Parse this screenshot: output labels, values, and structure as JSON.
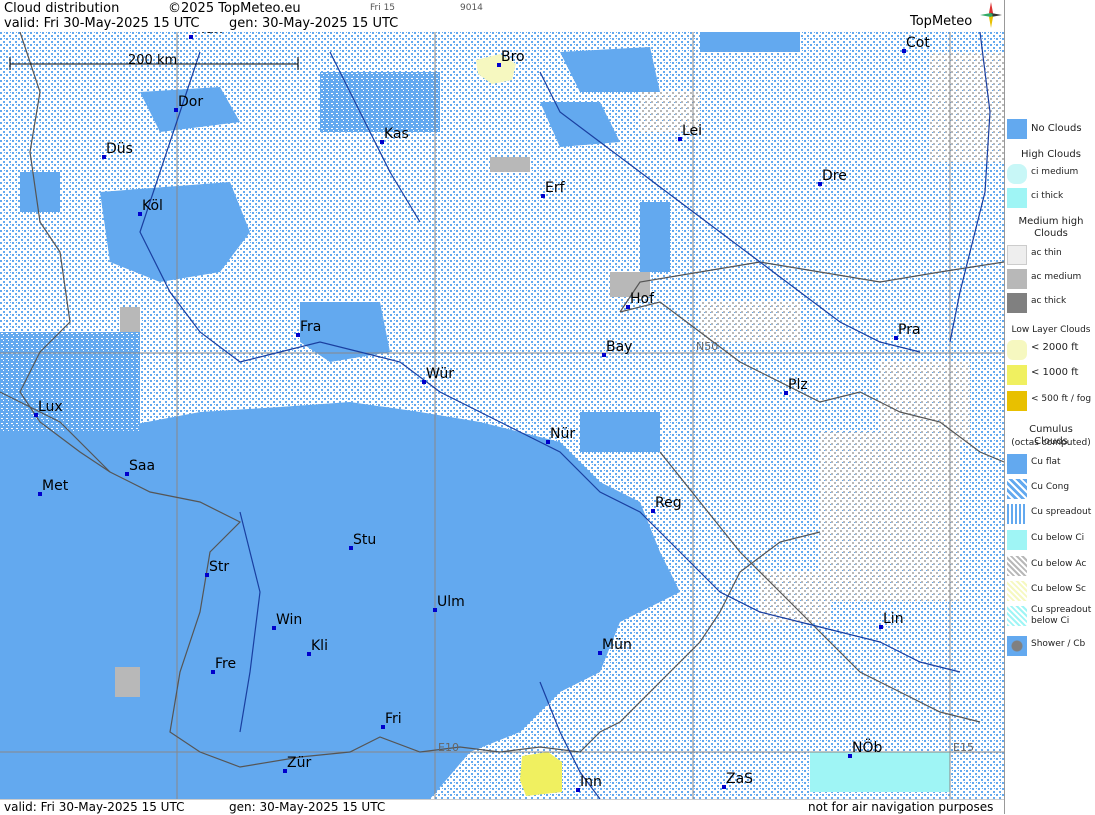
{
  "header": {
    "title": "Cloud distribution",
    "copyright": "©2025 TopMeteo.eu",
    "valid_label": "valid:  Fri  30-May-2025  15 UTC",
    "gen_label": "gen: 30-May-2025 15 UTC",
    "small_tag_1": "Fri 15",
    "small_tag_2": "9014",
    "brand": "TopMeteo"
  },
  "footer": {
    "valid_label": "valid:  Fri  30-May-2025  15 UTC",
    "gen_label": "gen: 30-May-2025 15 UTC",
    "disclaimer": "not for air navigation purposes"
  },
  "map": {
    "scale_label": "200 km",
    "grid_labels": {
      "n50": "N50",
      "e10": "E10",
      "e15": "E15"
    },
    "cities": [
      {
        "name": "Mün"
      },
      {
        "name": "Bro"
      },
      {
        "name": "Cot"
      },
      {
        "name": "Dor"
      },
      {
        "name": "Lei"
      },
      {
        "name": "Kas"
      },
      {
        "name": "Düs"
      },
      {
        "name": "Dre"
      },
      {
        "name": "Erf"
      },
      {
        "name": "Köl"
      },
      {
        "name": "Hof"
      },
      {
        "name": "Fra"
      },
      {
        "name": "Pra"
      },
      {
        "name": "Bay"
      },
      {
        "name": "Wür"
      },
      {
        "name": "Plz"
      },
      {
        "name": "Lux"
      },
      {
        "name": "Nür"
      },
      {
        "name": "Saa"
      },
      {
        "name": "Met"
      },
      {
        "name": "Reg"
      },
      {
        "name": "Stu"
      },
      {
        "name": "Str"
      },
      {
        "name": "Ulm"
      },
      {
        "name": "Win"
      },
      {
        "name": "Lin"
      },
      {
        "name": "Kli"
      },
      {
        "name": "Mün"
      },
      {
        "name": "Fre"
      },
      {
        "name": "Fri"
      },
      {
        "name": "NÖb"
      },
      {
        "name": "Zür"
      },
      {
        "name": "ZaS"
      },
      {
        "name": "Inn"
      }
    ]
  },
  "legend": {
    "no_clouds": "No Clouds",
    "high_head": "High Clouds",
    "ci_medium": "ci medium",
    "ci_thick": "ci thick",
    "medium_head": "Medium high Clouds",
    "ac_thin": "ac thin",
    "ac_medium": "ac medium",
    "ac_thick": "ac thick",
    "low_head": "Low Layer Clouds",
    "low_2000": "< 2000 ft",
    "low_1000": "< 1000 ft",
    "low_500": "< 500 ft / fog",
    "cu_head": "Cumulus Clouds",
    "cu_sub": "(octas computed)",
    "cu_flat": "Cu flat",
    "cu_cong": "Cu Cong",
    "cu_spreadout": "Cu spreadout",
    "cu_below_ci": "Cu below Ci",
    "cu_below_ac": "Cu below Ac",
    "cu_below_sc": "Cu below Sc",
    "cu_spreadout_ci_1": "Cu spreadout",
    "cu_spreadout_ci_2": "below Ci",
    "shower": "Shower / Cb"
  },
  "colors": {
    "no_clouds": "#63a9ef",
    "ci": "#9ff5f5",
    "ac": "#b8b8b8",
    "ac_thick": "#808080",
    "low_2000": "#f6f8c0",
    "low_1000": "#f0f060",
    "fog": "#e8c000",
    "border": "#555555",
    "river": "#1a3fa0",
    "city_marker": "#0000cc"
  }
}
